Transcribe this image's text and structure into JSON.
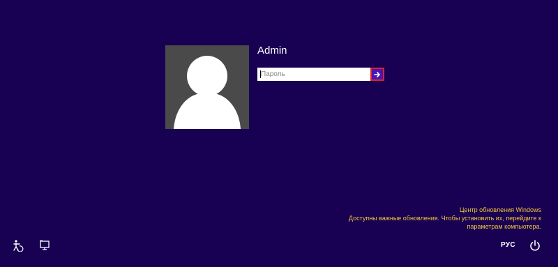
{
  "user": {
    "name": "Admin",
    "avatar_icon": "user-avatar-placeholder"
  },
  "password": {
    "placeholder": "Пароль",
    "value": "",
    "submit_icon": "arrow-right-icon",
    "submit_color": "#4617b4",
    "submit_border": "#e0202c"
  },
  "update_notice": {
    "line1": "Центр обновления Windows",
    "line2": "Доступны важные обновления. Чтобы установить их, перейдите к",
    "line3": "параметрам компьютера.",
    "color": "#f2c53d"
  },
  "bottom_bar": {
    "ease_of_access_icon": "ease-of-access-icon",
    "display_icon": "display-icon",
    "language_label": "РУС",
    "power_icon": "power-icon"
  },
  "background_color": "#180052"
}
